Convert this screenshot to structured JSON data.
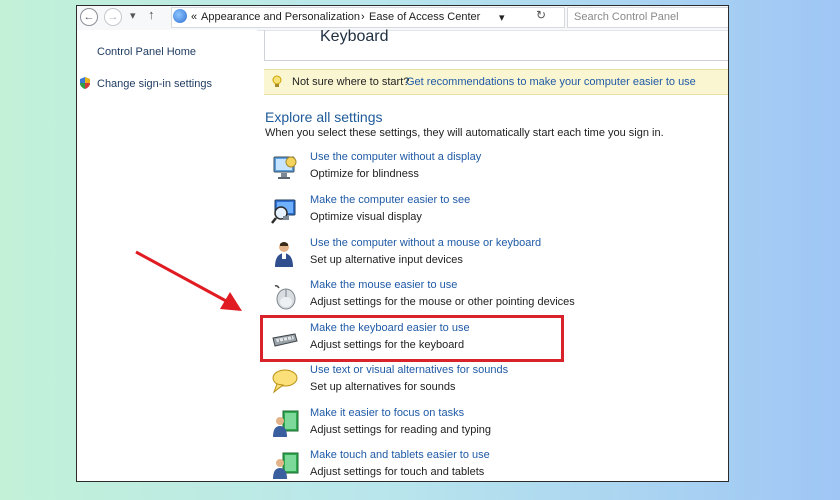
{
  "nav": {
    "back_glyph": "←",
    "forward_glyph": "→",
    "dropdown_glyph": "▾",
    "up_glyph": "↑",
    "chevrons": "«",
    "path_sep": "›",
    "breadcrumb": [
      "Appearance and Personalization",
      "Ease of Access Center"
    ],
    "refresh_glyph": "↻",
    "search_placeholder": "Search Control Panel"
  },
  "left_pane": {
    "home_link": "Control Panel Home",
    "signin_link": "Change sign-in settings"
  },
  "main": {
    "title": "Keyboard",
    "hint_question": "Not sure where to start?",
    "hint_link": "Get recommendations to make your computer easier to use",
    "section_title": "Explore all settings",
    "section_subtitle": "When you select these settings, they will automatically start each time you sign in.",
    "items": [
      {
        "link": "Use the computer without a display",
        "desc": "Optimize for blindness",
        "icon": "display-icon"
      },
      {
        "link": "Make the computer easier to see",
        "desc": "Optimize visual display",
        "icon": "magnifier-monitor-icon"
      },
      {
        "link": "Use the computer without a mouse or keyboard",
        "desc": "Set up alternative input devices",
        "icon": "person-icon"
      },
      {
        "link": "Make the mouse easier to use",
        "desc": "Adjust settings for the mouse or other pointing devices",
        "icon": "mouse-icon"
      },
      {
        "link": "Make the keyboard easier to use",
        "desc": "Adjust settings for the keyboard",
        "icon": "keyboard-icon"
      },
      {
        "link": "Use text or visual alternatives for sounds",
        "desc": "Set up alternatives for sounds",
        "icon": "speech-bubble-icon"
      },
      {
        "link": "Make it easier to focus on tasks",
        "desc": "Adjust settings for reading and typing",
        "icon": "person-board-icon"
      },
      {
        "link": "Make touch and tablets easier to use",
        "desc": "Adjust settings for touch and tablets",
        "icon": "person-tablet-icon"
      }
    ]
  },
  "colors": {
    "annotation_red": "#d9232a",
    "link_blue": "#1f5aa6"
  }
}
